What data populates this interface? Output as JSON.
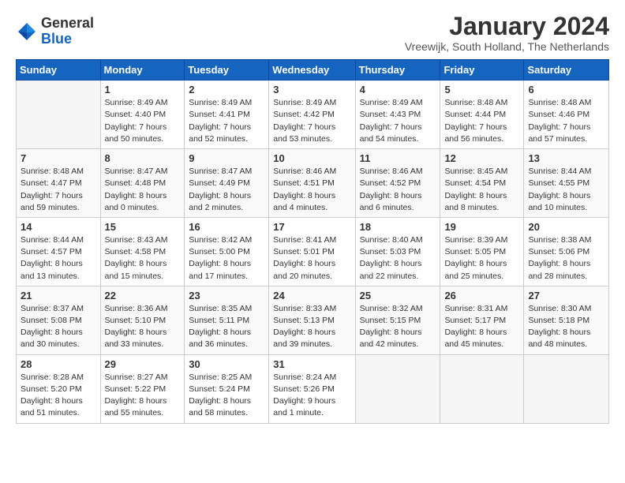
{
  "header": {
    "logo_general": "General",
    "logo_blue": "Blue",
    "month_title": "January 2024",
    "location": "Vreewijk, South Holland, The Netherlands"
  },
  "days_of_week": [
    "Sunday",
    "Monday",
    "Tuesday",
    "Wednesday",
    "Thursday",
    "Friday",
    "Saturday"
  ],
  "weeks": [
    [
      {
        "day": "",
        "sunrise": "",
        "sunset": "",
        "daylight": ""
      },
      {
        "day": "1",
        "sunrise": "Sunrise: 8:49 AM",
        "sunset": "Sunset: 4:40 PM",
        "daylight": "Daylight: 7 hours and 50 minutes."
      },
      {
        "day": "2",
        "sunrise": "Sunrise: 8:49 AM",
        "sunset": "Sunset: 4:41 PM",
        "daylight": "Daylight: 7 hours and 52 minutes."
      },
      {
        "day": "3",
        "sunrise": "Sunrise: 8:49 AM",
        "sunset": "Sunset: 4:42 PM",
        "daylight": "Daylight: 7 hours and 53 minutes."
      },
      {
        "day": "4",
        "sunrise": "Sunrise: 8:49 AM",
        "sunset": "Sunset: 4:43 PM",
        "daylight": "Daylight: 7 hours and 54 minutes."
      },
      {
        "day": "5",
        "sunrise": "Sunrise: 8:48 AM",
        "sunset": "Sunset: 4:44 PM",
        "daylight": "Daylight: 7 hours and 56 minutes."
      },
      {
        "day": "6",
        "sunrise": "Sunrise: 8:48 AM",
        "sunset": "Sunset: 4:46 PM",
        "daylight": "Daylight: 7 hours and 57 minutes."
      }
    ],
    [
      {
        "day": "7",
        "sunrise": "Sunrise: 8:48 AM",
        "sunset": "Sunset: 4:47 PM",
        "daylight": "Daylight: 7 hours and 59 minutes."
      },
      {
        "day": "8",
        "sunrise": "Sunrise: 8:47 AM",
        "sunset": "Sunset: 4:48 PM",
        "daylight": "Daylight: 8 hours and 0 minutes."
      },
      {
        "day": "9",
        "sunrise": "Sunrise: 8:47 AM",
        "sunset": "Sunset: 4:49 PM",
        "daylight": "Daylight: 8 hours and 2 minutes."
      },
      {
        "day": "10",
        "sunrise": "Sunrise: 8:46 AM",
        "sunset": "Sunset: 4:51 PM",
        "daylight": "Daylight: 8 hours and 4 minutes."
      },
      {
        "day": "11",
        "sunrise": "Sunrise: 8:46 AM",
        "sunset": "Sunset: 4:52 PM",
        "daylight": "Daylight: 8 hours and 6 minutes."
      },
      {
        "day": "12",
        "sunrise": "Sunrise: 8:45 AM",
        "sunset": "Sunset: 4:54 PM",
        "daylight": "Daylight: 8 hours and 8 minutes."
      },
      {
        "day": "13",
        "sunrise": "Sunrise: 8:44 AM",
        "sunset": "Sunset: 4:55 PM",
        "daylight": "Daylight: 8 hours and 10 minutes."
      }
    ],
    [
      {
        "day": "14",
        "sunrise": "Sunrise: 8:44 AM",
        "sunset": "Sunset: 4:57 PM",
        "daylight": "Daylight: 8 hours and 13 minutes."
      },
      {
        "day": "15",
        "sunrise": "Sunrise: 8:43 AM",
        "sunset": "Sunset: 4:58 PM",
        "daylight": "Daylight: 8 hours and 15 minutes."
      },
      {
        "day": "16",
        "sunrise": "Sunrise: 8:42 AM",
        "sunset": "Sunset: 5:00 PM",
        "daylight": "Daylight: 8 hours and 17 minutes."
      },
      {
        "day": "17",
        "sunrise": "Sunrise: 8:41 AM",
        "sunset": "Sunset: 5:01 PM",
        "daylight": "Daylight: 8 hours and 20 minutes."
      },
      {
        "day": "18",
        "sunrise": "Sunrise: 8:40 AM",
        "sunset": "Sunset: 5:03 PM",
        "daylight": "Daylight: 8 hours and 22 minutes."
      },
      {
        "day": "19",
        "sunrise": "Sunrise: 8:39 AM",
        "sunset": "Sunset: 5:05 PM",
        "daylight": "Daylight: 8 hours and 25 minutes."
      },
      {
        "day": "20",
        "sunrise": "Sunrise: 8:38 AM",
        "sunset": "Sunset: 5:06 PM",
        "daylight": "Daylight: 8 hours and 28 minutes."
      }
    ],
    [
      {
        "day": "21",
        "sunrise": "Sunrise: 8:37 AM",
        "sunset": "Sunset: 5:08 PM",
        "daylight": "Daylight: 8 hours and 30 minutes."
      },
      {
        "day": "22",
        "sunrise": "Sunrise: 8:36 AM",
        "sunset": "Sunset: 5:10 PM",
        "daylight": "Daylight: 8 hours and 33 minutes."
      },
      {
        "day": "23",
        "sunrise": "Sunrise: 8:35 AM",
        "sunset": "Sunset: 5:11 PM",
        "daylight": "Daylight: 8 hours and 36 minutes."
      },
      {
        "day": "24",
        "sunrise": "Sunrise: 8:33 AM",
        "sunset": "Sunset: 5:13 PM",
        "daylight": "Daylight: 8 hours and 39 minutes."
      },
      {
        "day": "25",
        "sunrise": "Sunrise: 8:32 AM",
        "sunset": "Sunset: 5:15 PM",
        "daylight": "Daylight: 8 hours and 42 minutes."
      },
      {
        "day": "26",
        "sunrise": "Sunrise: 8:31 AM",
        "sunset": "Sunset: 5:17 PM",
        "daylight": "Daylight: 8 hours and 45 minutes."
      },
      {
        "day": "27",
        "sunrise": "Sunrise: 8:30 AM",
        "sunset": "Sunset: 5:18 PM",
        "daylight": "Daylight: 8 hours and 48 minutes."
      }
    ],
    [
      {
        "day": "28",
        "sunrise": "Sunrise: 8:28 AM",
        "sunset": "Sunset: 5:20 PM",
        "daylight": "Daylight: 8 hours and 51 minutes."
      },
      {
        "day": "29",
        "sunrise": "Sunrise: 8:27 AM",
        "sunset": "Sunset: 5:22 PM",
        "daylight": "Daylight: 8 hours and 55 minutes."
      },
      {
        "day": "30",
        "sunrise": "Sunrise: 8:25 AM",
        "sunset": "Sunset: 5:24 PM",
        "daylight": "Daylight: 8 hours and 58 minutes."
      },
      {
        "day": "31",
        "sunrise": "Sunrise: 8:24 AM",
        "sunset": "Sunset: 5:26 PM",
        "daylight": "Daylight: 9 hours and 1 minute."
      },
      {
        "day": "",
        "sunrise": "",
        "sunset": "",
        "daylight": ""
      },
      {
        "day": "",
        "sunrise": "",
        "sunset": "",
        "daylight": ""
      },
      {
        "day": "",
        "sunrise": "",
        "sunset": "",
        "daylight": ""
      }
    ]
  ]
}
